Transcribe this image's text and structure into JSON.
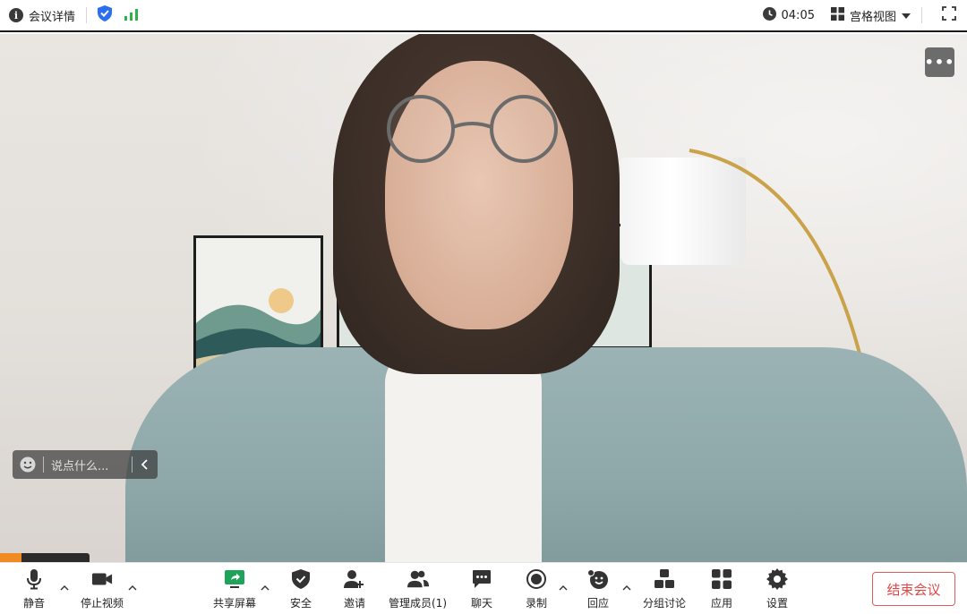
{
  "topbar": {
    "meeting_info_label": "会议详情",
    "timer": "04:05",
    "view_label": "宫格视图"
  },
  "video": {
    "chat_placeholder": "说点什么..."
  },
  "toolbar": {
    "mute": "静音",
    "stop_video": "停止视频",
    "share_screen": "共享屏幕",
    "security": "安全",
    "invite": "邀请",
    "manage_members": "管理成员(1)",
    "chat": "聊天",
    "record": "录制",
    "reactions": "回应",
    "breakout": "分组讨论",
    "apps": "应用",
    "settings": "设置",
    "end_meeting": "结束会议"
  },
  "colors": {
    "shield_blue": "#2b6ff0",
    "signal_green": "#2cb34a",
    "share_green": "#1ea35a",
    "end_red": "#e04747"
  }
}
